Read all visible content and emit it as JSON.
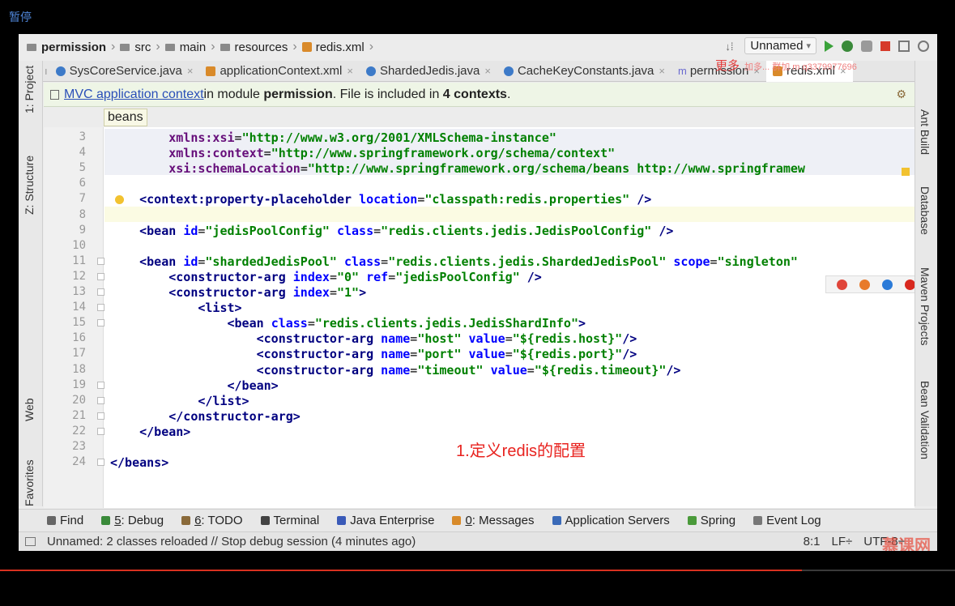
{
  "overlay": {
    "pause": "暂停",
    "annotation": "1.定义redis的配置",
    "watermark_title": "更多",
    "watermark_extra": "加多... 群加 m q3379977696",
    "site_logo": "慕课网"
  },
  "breadcrumb": [
    "permission",
    "src",
    "main",
    "resources",
    "redis.xml"
  ],
  "run_config": "Unnamed",
  "tabs": [
    {
      "label": "SysCoreService.java",
      "icon": "class-icon"
    },
    {
      "label": "applicationContext.xml",
      "icon": "xml-icon"
    },
    {
      "label": "ShardedJedis.java",
      "icon": "class-icon"
    },
    {
      "label": "CacheKeyConstants.java",
      "icon": "class-icon"
    },
    {
      "label": "permission",
      "icon": "module-icon"
    },
    {
      "label": "redis.xml",
      "icon": "xml-icon",
      "active": true
    }
  ],
  "left_tools": [
    "1: Project",
    "Z: Structure",
    "Web",
    "Favorites"
  ],
  "right_tools": [
    "Ant Build",
    "Database",
    "Maven Projects",
    "Bean Validation"
  ],
  "banner": {
    "link": "MVC application context",
    "text1": "in module ",
    "module": "permission",
    "text2": ". File is included in ",
    "count": "4 contexts",
    "text3": "."
  },
  "crumb_popup": "beans",
  "code_lines": [
    {
      "n": "3",
      "parts": [
        [
          "ind",
          "        "
        ],
        [
          "ns",
          "xmlns:xsi"
        ],
        [
          "t",
          "="
        ],
        [
          "val",
          "\"http://www.w3.org/2001/XMLSchema-instance\""
        ]
      ]
    },
    {
      "n": "4",
      "parts": [
        [
          "ind",
          "        "
        ],
        [
          "ns",
          "xmlns:context"
        ],
        [
          "t",
          "="
        ],
        [
          "val",
          "\"http://www.springframework.org/schema/context\""
        ]
      ]
    },
    {
      "n": "5",
      "parts": [
        [
          "ind",
          "        "
        ],
        [
          "ns",
          "xsi:schemaLocation"
        ],
        [
          "t",
          "="
        ],
        [
          "val",
          "\"http://www.springframework.org/schema/beans http://www.springframew"
        ]
      ]
    },
    {
      "n": "6",
      "parts": []
    },
    {
      "n": "7",
      "parts": [
        [
          "ind",
          "    "
        ],
        [
          "tag",
          "<context:property-placeholder "
        ],
        [
          "attr",
          "location"
        ],
        [
          "t",
          "="
        ],
        [
          "val",
          "\"classpath:redis.properties\""
        ],
        [
          "tag",
          " />"
        ]
      ]
    },
    {
      "n": "8",
      "parts": []
    },
    {
      "n": "9",
      "parts": [
        [
          "ind",
          "    "
        ],
        [
          "tag",
          "<bean "
        ],
        [
          "attr",
          "id"
        ],
        [
          "t",
          "="
        ],
        [
          "val",
          "\"jedisPoolConfig\""
        ],
        [
          "t",
          " "
        ],
        [
          "attr",
          "class"
        ],
        [
          "t",
          "="
        ],
        [
          "val",
          "\"redis.clients.jedis.JedisPoolConfig\""
        ],
        [
          "tag",
          " />"
        ]
      ]
    },
    {
      "n": "10",
      "parts": []
    },
    {
      "n": "11",
      "parts": [
        [
          "ind",
          "    "
        ],
        [
          "tag",
          "<bean "
        ],
        [
          "attr",
          "id"
        ],
        [
          "t",
          "="
        ],
        [
          "val",
          "\"shardedJedisPool\""
        ],
        [
          "t",
          " "
        ],
        [
          "attr",
          "class"
        ],
        [
          "t",
          "="
        ],
        [
          "val",
          "\"redis.clients.jedis.ShardedJedisPool\""
        ],
        [
          "t",
          " "
        ],
        [
          "attr",
          "scope"
        ],
        [
          "t",
          "="
        ],
        [
          "val",
          "\"singleton\""
        ]
      ]
    },
    {
      "n": "12",
      "parts": [
        [
          "ind",
          "        "
        ],
        [
          "tag",
          "<constructor-arg "
        ],
        [
          "attr",
          "index"
        ],
        [
          "t",
          "="
        ],
        [
          "val",
          "\"0\""
        ],
        [
          "t",
          " "
        ],
        [
          "attr",
          "ref"
        ],
        [
          "t",
          "="
        ],
        [
          "val",
          "\"jedisPoolConfig\""
        ],
        [
          "tag",
          " />"
        ]
      ]
    },
    {
      "n": "13",
      "parts": [
        [
          "ind",
          "        "
        ],
        [
          "tag",
          "<constructor-arg "
        ],
        [
          "attr",
          "index"
        ],
        [
          "t",
          "="
        ],
        [
          "val",
          "\"1\""
        ],
        [
          "tag",
          ">"
        ]
      ]
    },
    {
      "n": "14",
      "parts": [
        [
          "ind",
          "            "
        ],
        [
          "tag",
          "<list>"
        ]
      ]
    },
    {
      "n": "15",
      "parts": [
        [
          "ind",
          "                "
        ],
        [
          "tag",
          "<bean "
        ],
        [
          "attr",
          "class"
        ],
        [
          "t",
          "="
        ],
        [
          "val",
          "\"redis.clients.jedis.JedisShardInfo\""
        ],
        [
          "tag",
          ">"
        ]
      ]
    },
    {
      "n": "16",
      "parts": [
        [
          "ind",
          "                    "
        ],
        [
          "tag",
          "<constructor-arg "
        ],
        [
          "attr",
          "name"
        ],
        [
          "t",
          "="
        ],
        [
          "val",
          "\"host\""
        ],
        [
          "t",
          " "
        ],
        [
          "attr",
          "value"
        ],
        [
          "t",
          "="
        ],
        [
          "val",
          "\"${redis.host}\""
        ],
        [
          "tag",
          "/>"
        ]
      ]
    },
    {
      "n": "17",
      "parts": [
        [
          "ind",
          "                    "
        ],
        [
          "tag",
          "<constructor-arg "
        ],
        [
          "attr",
          "name"
        ],
        [
          "t",
          "="
        ],
        [
          "val",
          "\"port\""
        ],
        [
          "t",
          " "
        ],
        [
          "attr",
          "value"
        ],
        [
          "t",
          "="
        ],
        [
          "val",
          "\"${redis.port}\""
        ],
        [
          "tag",
          "/>"
        ]
      ]
    },
    {
      "n": "18",
      "parts": [
        [
          "ind",
          "                    "
        ],
        [
          "tag",
          "<constructor-arg "
        ],
        [
          "attr",
          "name"
        ],
        [
          "t",
          "="
        ],
        [
          "val",
          "\"timeout\""
        ],
        [
          "t",
          " "
        ],
        [
          "attr",
          "value"
        ],
        [
          "t",
          "="
        ],
        [
          "val",
          "\"${redis.timeout}\""
        ],
        [
          "tag",
          "/>"
        ]
      ]
    },
    {
      "n": "19",
      "parts": [
        [
          "ind",
          "                "
        ],
        [
          "tag",
          "</bean>"
        ]
      ]
    },
    {
      "n": "20",
      "parts": [
        [
          "ind",
          "            "
        ],
        [
          "tag",
          "</list>"
        ]
      ]
    },
    {
      "n": "21",
      "parts": [
        [
          "ind",
          "        "
        ],
        [
          "tag",
          "</constructor-arg>"
        ]
      ]
    },
    {
      "n": "22",
      "parts": [
        [
          "ind",
          "    "
        ],
        [
          "tag",
          "</bean>"
        ]
      ]
    },
    {
      "n": "23",
      "parts": []
    },
    {
      "n": "24",
      "parts": [
        [
          "tag",
          "</beans>"
        ]
      ]
    }
  ],
  "tool_tabs": [
    {
      "label": "Find",
      "icon": "search-icon"
    },
    {
      "key": "5",
      "label": ": Debug",
      "icon": "bug-icon"
    },
    {
      "key": "6",
      "label": ": TODO",
      "icon": "todo-icon"
    },
    {
      "label": "Terminal",
      "icon": "terminal-icon"
    },
    {
      "label": "Java Enterprise",
      "icon": "java-enterprise-icon"
    },
    {
      "key": "0",
      "label": ": Messages",
      "icon": "messages-icon"
    },
    {
      "label": "Application Servers",
      "icon": "server-icon"
    },
    {
      "label": "Spring",
      "icon": "spring-icon"
    },
    {
      "label": "Event Log",
      "icon": "event-log-icon"
    }
  ],
  "status": {
    "message": "Unnamed: 2 classes reloaded // Stop debug session (4 minutes ago)",
    "position": "8:1",
    "line_sep": "LF÷",
    "encoding": "UTF-8÷"
  },
  "video_progress": 0.84
}
